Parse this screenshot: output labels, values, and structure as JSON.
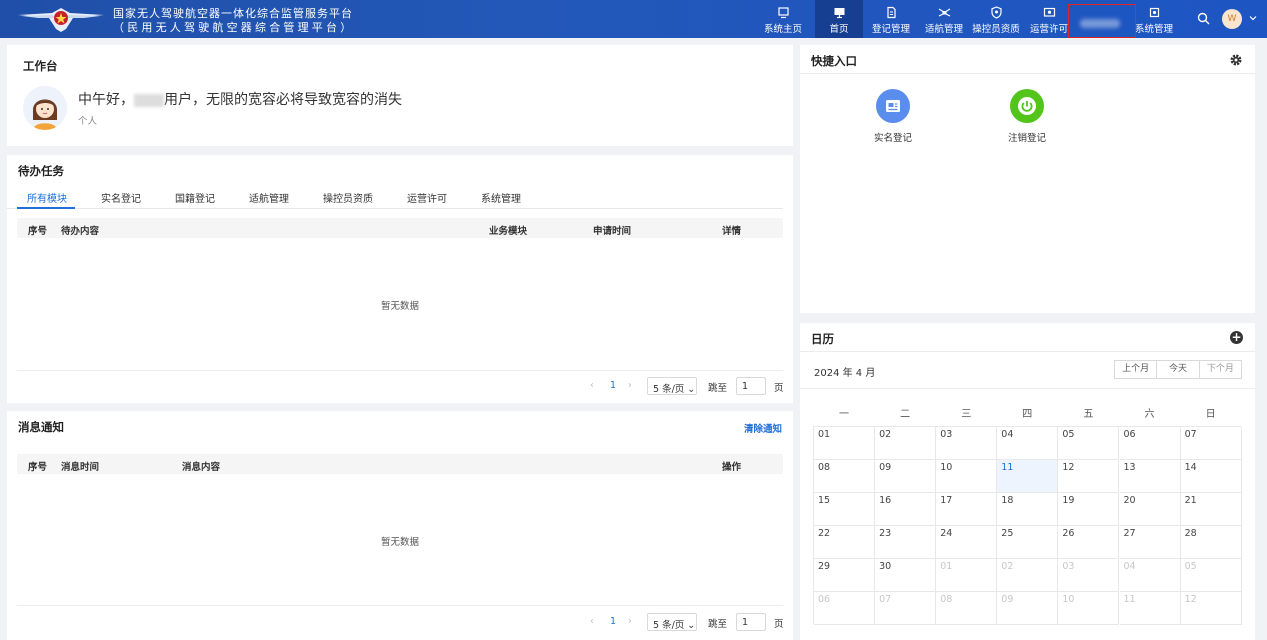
{
  "header": {
    "title_line1": "国家无人驾驶航空器一体化综合监管服务平台",
    "title_line2": "（民用无人驾驶航空器综合管理平台）",
    "nav": [
      {
        "label": "系统主页",
        "icon": "monitor-icon"
      },
      {
        "label": "首页",
        "icon": "desktop-icon",
        "active": true
      },
      {
        "label": "登记管理",
        "icon": "document-edit-icon"
      },
      {
        "label": "适航管理",
        "icon": "drone-icon"
      },
      {
        "label": "操控员资质",
        "icon": "shield-icon"
      },
      {
        "label": "运营许可",
        "icon": "certificate-icon"
      },
      {
        "label": "",
        "icon": "redacted-icon"
      },
      {
        "label": "系统管理",
        "icon": "settings-icon"
      }
    ],
    "avatar_initial": "W",
    "colors": {
      "header_bg": "#2358b8",
      "accent": "#1e6fd9",
      "highlight_box": "#e02424"
    }
  },
  "workbench": {
    "title": "工作台",
    "greeting_prefix": "中午好，",
    "greeting_suffix": "用户，无限的宽容必将导致宽容的消失",
    "role": "个人"
  },
  "todo": {
    "title": "待办任务",
    "tabs": [
      "所有模块",
      "实名登记",
      "国籍登记",
      "适航管理",
      "操控员资质",
      "运营许可",
      "系统管理"
    ],
    "columns": [
      "序号",
      "待办内容",
      "业务模块",
      "申请时间",
      "详情"
    ],
    "empty_text": "暂无数据",
    "pagination": {
      "prev": "‹",
      "page": "1",
      "next": "›",
      "page_size": "5 条/页",
      "goto_label": "跳至",
      "goto_value": "1",
      "page_unit": "页"
    }
  },
  "messages": {
    "title": "消息通知",
    "clear_label": "清除通知",
    "columns": [
      "序号",
      "消息时间",
      "消息内容",
      "操作"
    ],
    "empty_text": "暂无数据",
    "pagination": {
      "prev": "‹",
      "page": "1",
      "next": "›",
      "page_size": "5 条/页",
      "goto_label": "跳至",
      "goto_value": "1",
      "page_unit": "页"
    }
  },
  "quick": {
    "title": "快捷入口",
    "items": [
      {
        "label": "实名登记",
        "icon": "id-card-icon",
        "color": "#5b8def"
      },
      {
        "label": "注销登记",
        "icon": "power-icon",
        "color": "#52c41a"
      }
    ]
  },
  "calendar": {
    "title": "日历",
    "month_label": "2024 年 4 月",
    "buttons": [
      "上个月",
      "今天",
      "下个月"
    ],
    "weekdays": [
      "一",
      "二",
      "三",
      "四",
      "五",
      "六",
      "日"
    ],
    "weeks": [
      [
        "01",
        "02",
        "03",
        "04",
        "05",
        "06",
        "07"
      ],
      [
        "08",
        "09",
        "10",
        "11",
        "12",
        "13",
        "14"
      ],
      [
        "15",
        "16",
        "17",
        "18",
        "19",
        "20",
        "21"
      ],
      [
        "22",
        "23",
        "24",
        "25",
        "26",
        "27",
        "28"
      ],
      [
        "29",
        "30",
        "01",
        "02",
        "03",
        "04",
        "05"
      ],
      [
        "06",
        "07",
        "08",
        "09",
        "10",
        "11",
        "12"
      ]
    ],
    "today": "11"
  }
}
